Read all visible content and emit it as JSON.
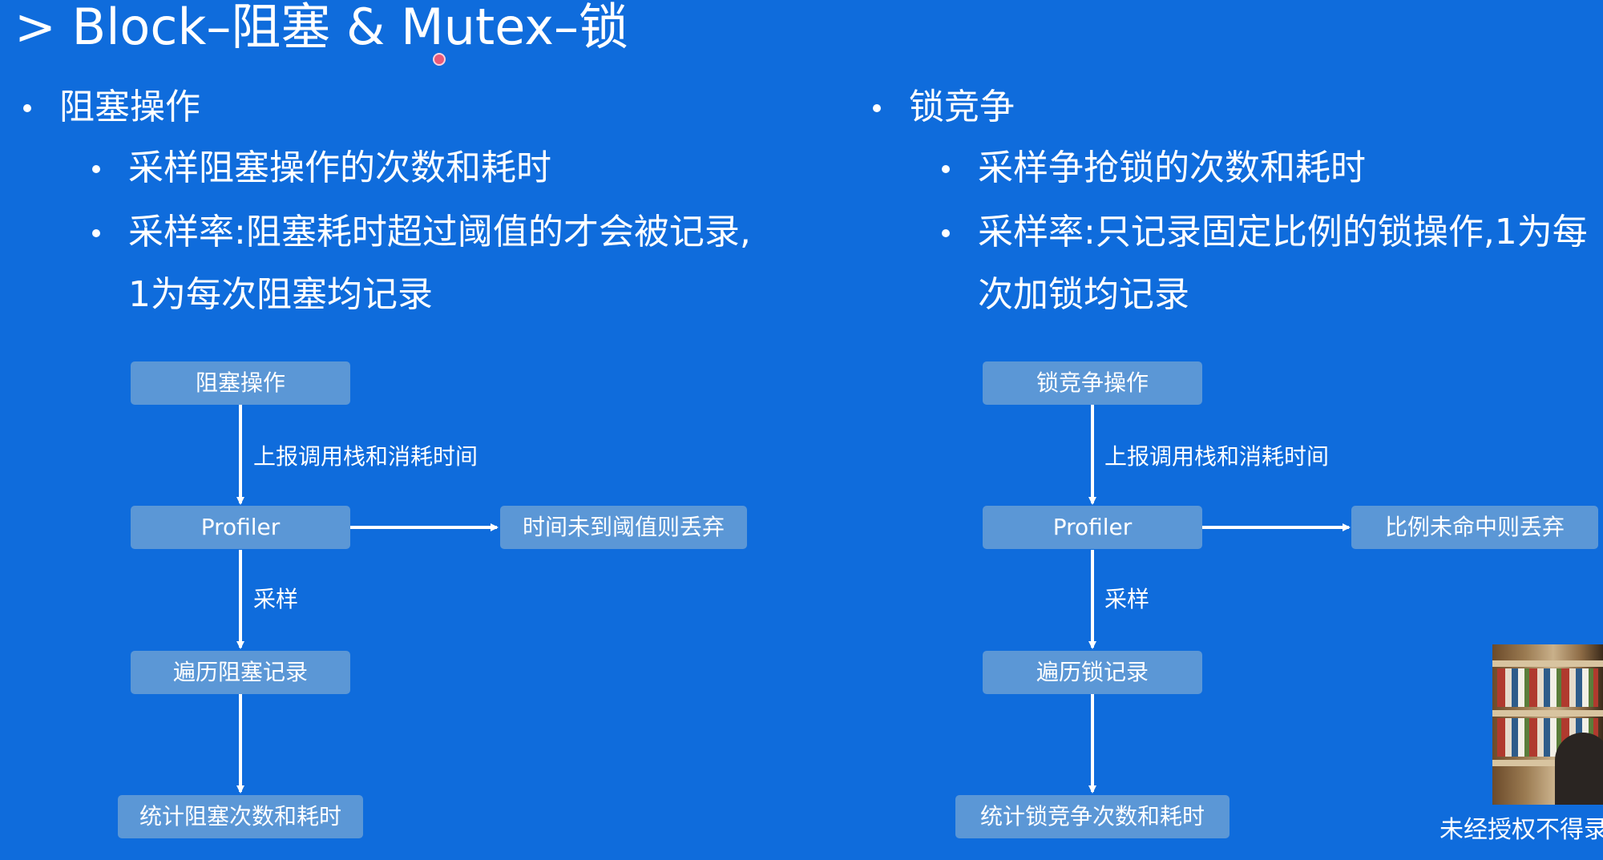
{
  "title": "> Block–阻塞 & Mutex–锁",
  "left": {
    "heading": "阻塞操作",
    "sub1": "采样阻塞操作的次数和耗时",
    "sub2_line1": "采样率:阻塞耗时超过阈值的才会被记录,",
    "sub2_line2": "1为每次阻塞均记录",
    "flow": {
      "start": "阻塞操作",
      "edge1": "上报调用栈和消耗时间",
      "profiler": "Profiler",
      "discard": "时间未到阈值则丢弃",
      "edge2": "采样",
      "traverse": "遍历阻塞记录",
      "result": "统计阻塞次数和耗时"
    }
  },
  "right": {
    "heading": "锁竞争",
    "sub1": "采样争抢锁的次数和耗时",
    "sub2_line1": "采样率:只记录固定比例的锁操作,1为每",
    "sub2_line2": "次加锁均记录",
    "flow": {
      "start": "锁竞争操作",
      "edge1": "上报调用栈和消耗时间",
      "profiler": "Profiler",
      "discard": "比例未命中则丢弃",
      "edge2": "采样",
      "traverse": "遍历锁记录",
      "result": "统计锁竞争次数和耗时"
    }
  },
  "watermark": "未经授权不得录",
  "colors": {
    "background": "#0f6cdc",
    "node": "#5b97d6",
    "text": "#ffffff"
  }
}
